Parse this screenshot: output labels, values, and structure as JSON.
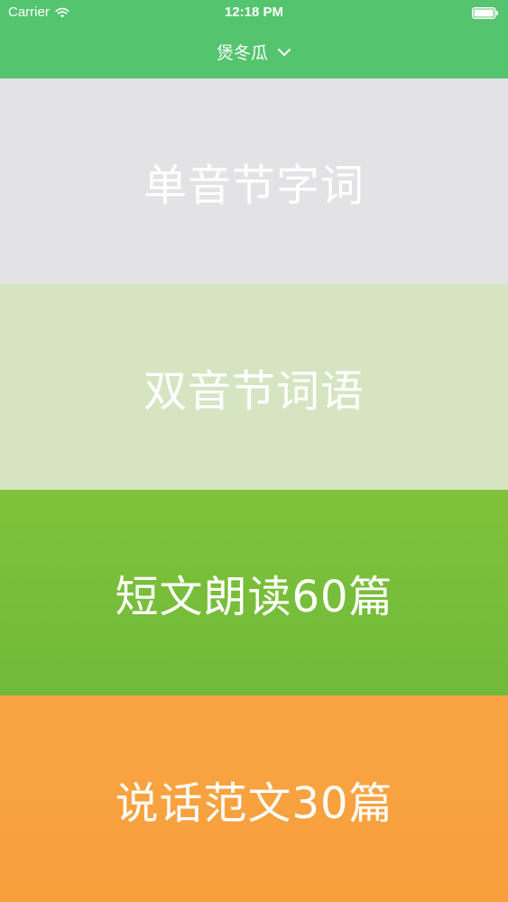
{
  "status_bar": {
    "carrier": "Carrier",
    "time": "12:18 PM",
    "wifi_icon": "wifi-icon",
    "battery_icon": "battery-icon"
  },
  "nav": {
    "title": "煲冬瓜",
    "dropdown_icon": "chevron-down-icon",
    "bar_color": "#55c46e"
  },
  "menu": {
    "items": [
      {
        "label": "单音节字词",
        "color": "#e3e2e4"
      },
      {
        "label": "双音节词语",
        "color": "#d5e5c2"
      },
      {
        "label": "短文朗读60篇",
        "color": "#7bbf3a"
      },
      {
        "label": "说话范文30篇",
        "color": "#f8a443"
      }
    ]
  }
}
